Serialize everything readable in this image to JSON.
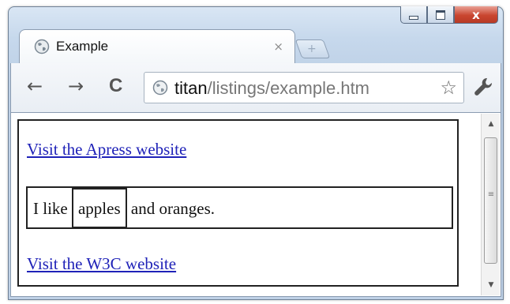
{
  "window": {
    "controls": {
      "minimize_icon": "minimize-icon",
      "maximize_icon": "maximize-icon",
      "close_label": "x"
    }
  },
  "tabs": [
    {
      "title": "Example",
      "close_label": "×",
      "icon": "globe-icon"
    }
  ],
  "new_tab_label": "+",
  "toolbar": {
    "back_label": "←",
    "forward_label": "→",
    "reload_label": "C",
    "address": {
      "host": "titan",
      "path": "/listings/example.htm"
    },
    "bookmark_label": "☆"
  },
  "page": {
    "link1": "Visit the Apress website",
    "paragraph_before": "I like ",
    "paragraph_highlight": "apples",
    "paragraph_after": " and oranges.",
    "link2": "Visit the W3C website"
  },
  "scrollbar": {
    "up_label": "▲",
    "down_label": "▼",
    "grip_label": "≡"
  },
  "colors": {
    "link": "#1f22b8",
    "close_button": "#c9452f",
    "frame": "#c6d8ec"
  }
}
